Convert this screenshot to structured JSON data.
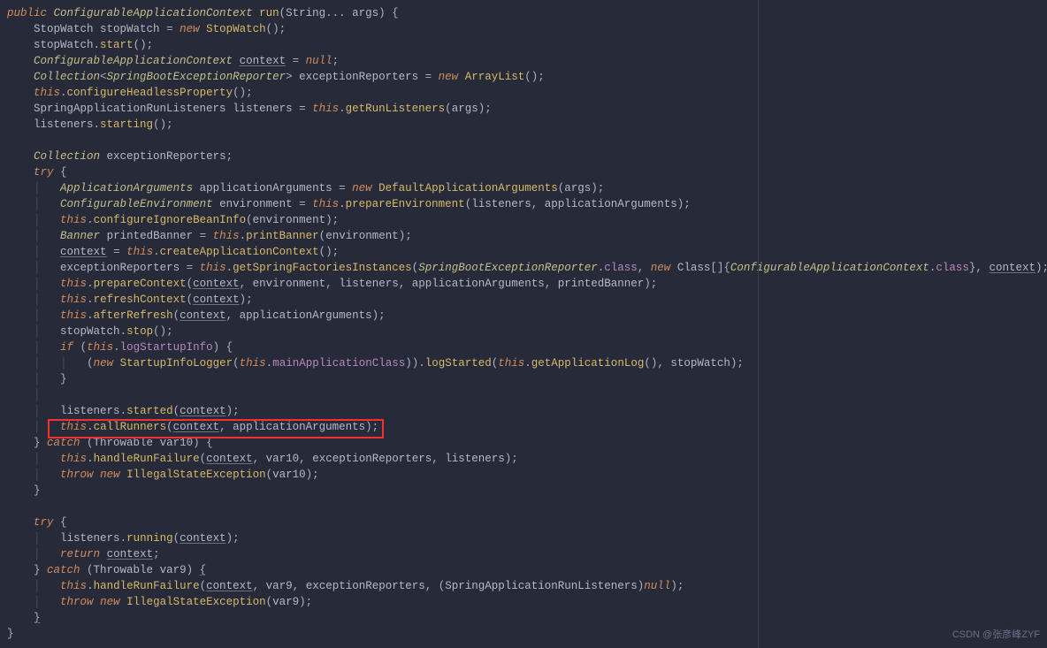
{
  "watermark": "CSDN @张彦峰ZYF",
  "code": {
    "l1": {
      "kw_public": "public",
      "type_cac": "ConfigurableApplicationContext",
      "method_run": "run",
      "param_type": "String",
      "param_args": "args"
    },
    "l2": {
      "type_sw": "StopWatch",
      "var_sw": "stopWatch",
      "kw_new": "new",
      "ctor": "StopWatch"
    },
    "l3": {
      "var_sw": "stopWatch",
      "m_start": "start"
    },
    "l4": {
      "type_cac": "ConfigurableApplicationContext",
      "var_ctx": "context",
      "kw_null": "null"
    },
    "l5": {
      "type_col": "Collection",
      "type_sber": "SpringBootExceptionReporter",
      "var_er": "exceptionReporters",
      "kw_new": "new",
      "type_al": "ArrayList"
    },
    "l6": {
      "kw_this": "this",
      "m_conf": "configureHeadlessProperty"
    },
    "l7": {
      "type_sarl": "SpringApplicationRunListeners",
      "var_lis": "listeners",
      "kw_this": "this",
      "m_grl": "getRunListeners",
      "var_args": "args"
    },
    "l8": {
      "var_lis": "listeners",
      "m_starting": "starting"
    },
    "l10": {
      "type_col": "Collection",
      "var_er": "exceptionReporters"
    },
    "l11": {
      "kw_try": "try"
    },
    "l12": {
      "type_aa": "ApplicationArguments",
      "var_aa": "applicationArguments",
      "kw_new": "new",
      "type_daa": "DefaultApplicationArguments",
      "var_args": "args"
    },
    "l13": {
      "type_ce": "ConfigurableEnvironment",
      "var_env": "environment",
      "kw_this": "this",
      "m_pe": "prepareEnvironment",
      "var_lis": "listeners",
      "var_aa": "applicationArguments"
    },
    "l14": {
      "kw_this": "this",
      "m_cibi": "configureIgnoreBeanInfo",
      "var_env": "environment"
    },
    "l15": {
      "type_ban": "Banner",
      "var_pb": "printedBanner",
      "kw_this": "this",
      "m_pb": "printBanner",
      "var_env": "environment"
    },
    "l16": {
      "var_ctx": "context",
      "kw_this": "this",
      "m_cac": "createApplicationContext"
    },
    "l17": {
      "var_er": "exceptionReporters",
      "kw_this": "this",
      "m_gsfi": "getSpringFactoriesInstances",
      "type_sber": "SpringBootExceptionReporter",
      "field_class": "class",
      "kw_new": "new",
      "type_class": "Class",
      "type_cac": "ConfigurableApplicationContext",
      "var_ctx2": "context"
    },
    "l18": {
      "kw_this": "this",
      "m_pc": "prepareContext",
      "var_ctx": "context",
      "var_env": "environment",
      "var_lis": "listeners",
      "var_aa": "applicationArguments",
      "var_pb": "printedBanner"
    },
    "l19": {
      "kw_this": "this",
      "m_rc": "refreshContext",
      "var_ctx": "context"
    },
    "l20": {
      "kw_this": "this",
      "m_ar": "afterRefresh",
      "var_ctx": "context",
      "var_aa": "applicationArguments"
    },
    "l21": {
      "var_sw": "stopWatch",
      "m_stop": "stop"
    },
    "l22": {
      "kw_if": "if",
      "kw_this": "this",
      "field_lsi": "logStartupInfo"
    },
    "l23": {
      "kw_new": "new",
      "type_sil": "StartupInfoLogger",
      "kw_this": "this",
      "field_mac": "mainApplicationClass",
      "m_ls": "logStarted",
      "kw_this2": "this",
      "m_gal": "getApplicationLog",
      "var_sw": "stopWatch"
    },
    "l26": {
      "var_lis": "listeners",
      "m_started": "started",
      "var_ctx": "context"
    },
    "l27": {
      "kw_this": "this",
      "m_cr": "callRunners",
      "var_ctx": "context",
      "var_aa": "applicationArguments"
    },
    "l28": {
      "kw_catch": "catch",
      "type_thr": "Throwable",
      "var_v10": "var10"
    },
    "l29": {
      "kw_this": "this",
      "m_hrf": "handleRunFailure",
      "var_ctx": "context",
      "var_v10": "var10",
      "var_er": "exceptionReporters",
      "var_lis": "listeners"
    },
    "l30": {
      "kw_throw": "throw",
      "kw_new": "new",
      "type_ise": "IllegalStateException",
      "var_v10": "var10"
    },
    "l33": {
      "kw_try": "try"
    },
    "l34": {
      "var_lis": "listeners",
      "m_running": "running",
      "var_ctx": "context"
    },
    "l35": {
      "kw_return": "return",
      "var_ctx": "context"
    },
    "l36": {
      "kw_catch": "catch",
      "type_thr": "Throwable",
      "var_v9": "var9",
      "brace": "{"
    },
    "l37": {
      "kw_this": "this",
      "m_hrf": "handleRunFailure",
      "var_ctx": "context",
      "var_v9": "var9",
      "var_er": "exceptionReporters",
      "type_sarl": "SpringApplicationRunListeners",
      "kw_null": "null"
    },
    "l38": {
      "kw_throw": "throw",
      "kw_new": "new",
      "type_ise": "IllegalStateException",
      "var_v9": "var9"
    },
    "l39": {
      "brace": "}"
    }
  }
}
